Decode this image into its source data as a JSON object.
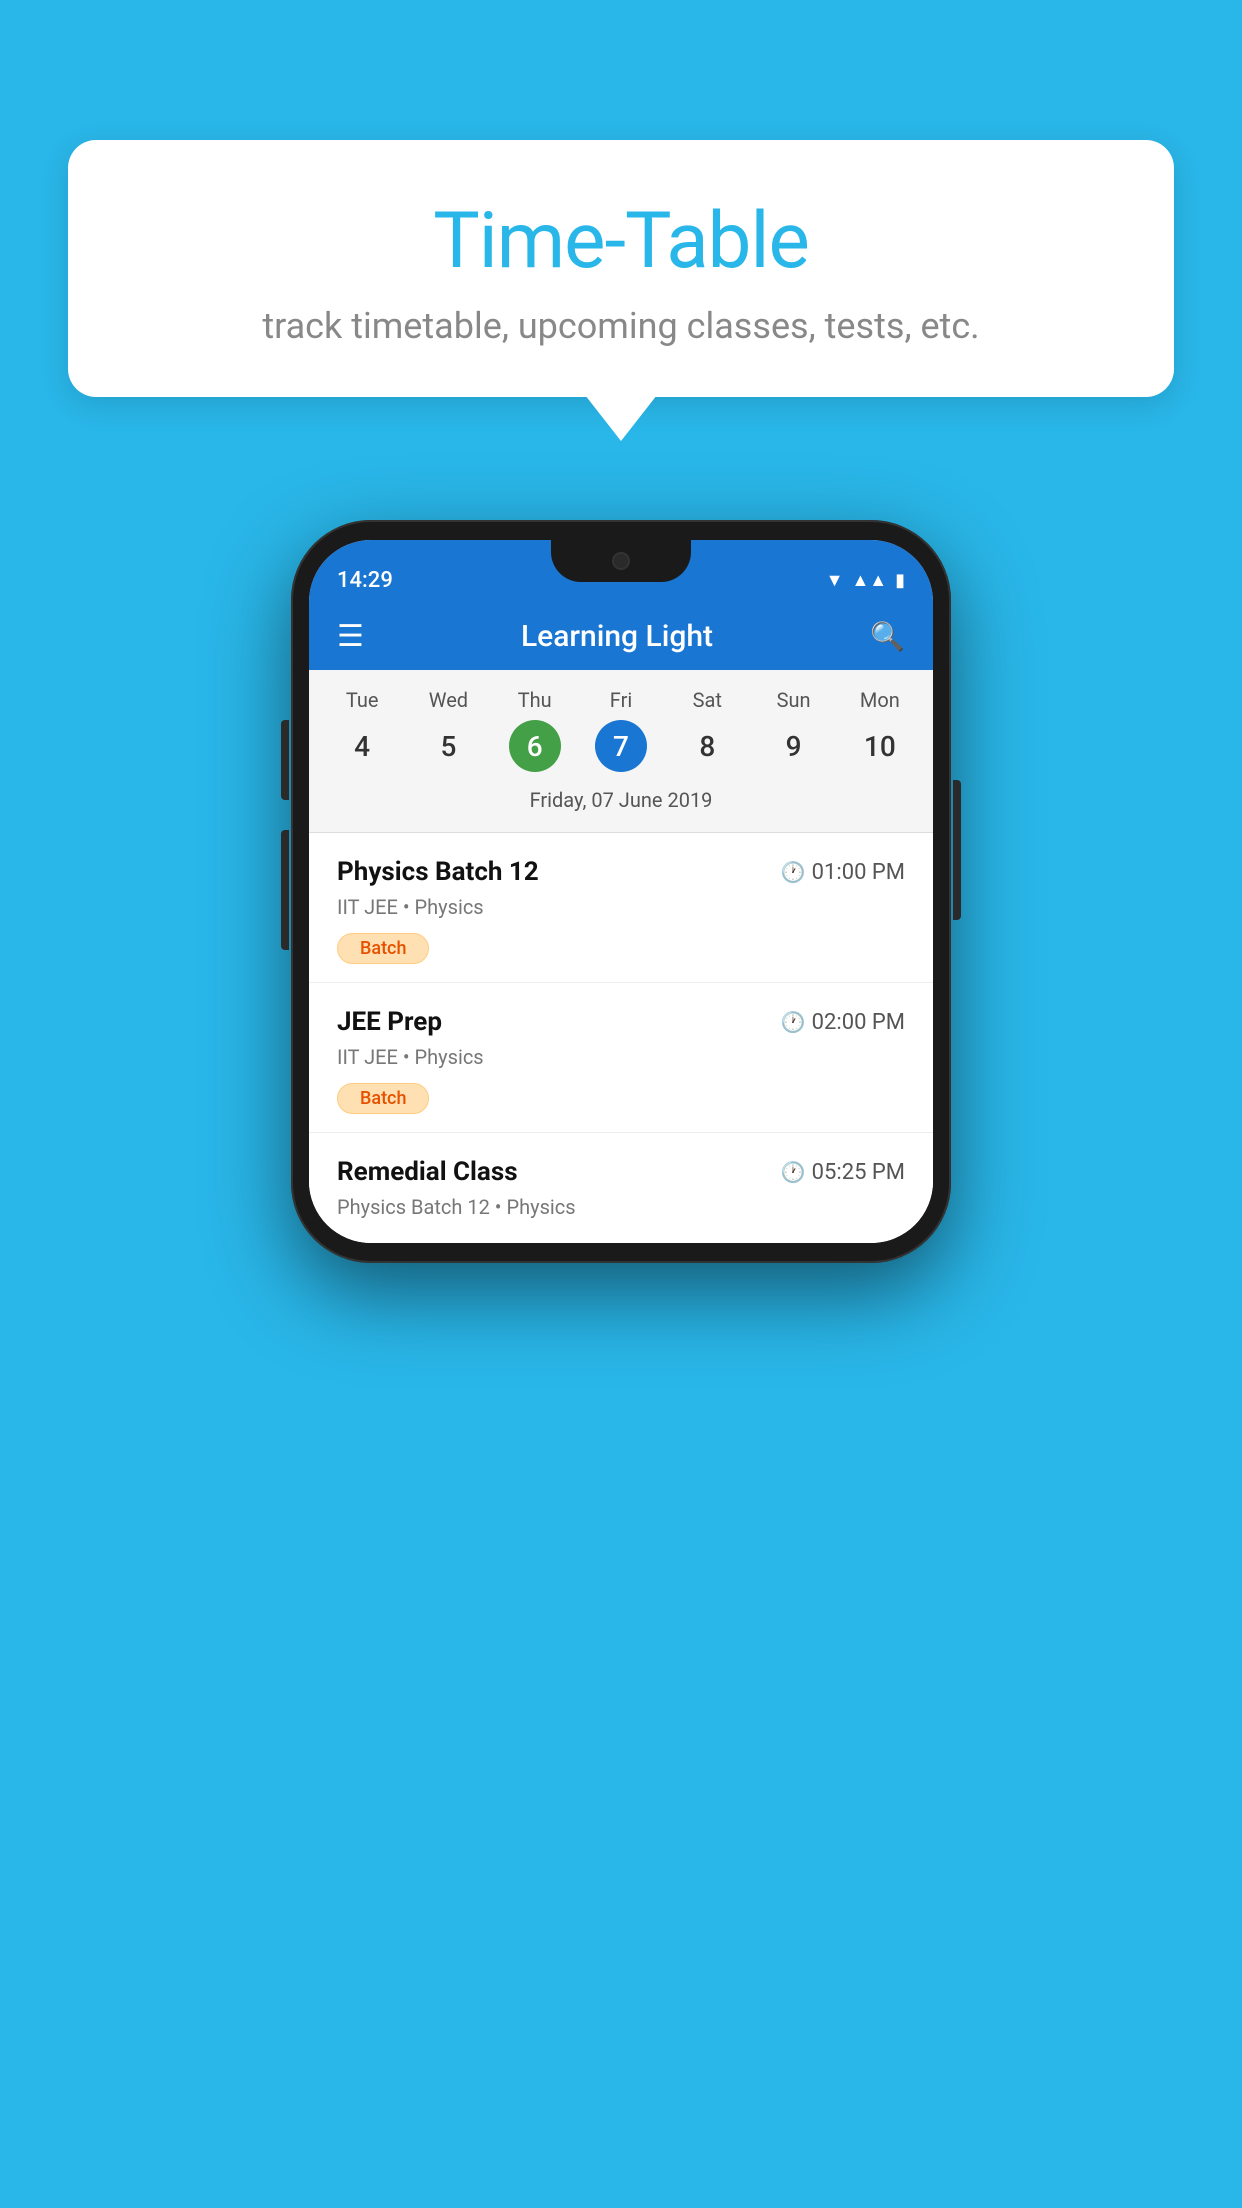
{
  "background_color": "#29b6e8",
  "tooltip": {
    "title": "Time-Table",
    "subtitle": "track timetable, upcoming classes, tests, etc."
  },
  "phone": {
    "status_bar": {
      "time": "14:29"
    },
    "app_bar": {
      "title": "Learning Light"
    },
    "calendar": {
      "days": [
        {
          "label": "Tue",
          "num": "4"
        },
        {
          "label": "Wed",
          "num": "5"
        },
        {
          "label": "Thu",
          "num": "6",
          "state": "today"
        },
        {
          "label": "Fri",
          "num": "7",
          "state": "selected"
        },
        {
          "label": "Sat",
          "num": "8"
        },
        {
          "label": "Sun",
          "num": "9"
        },
        {
          "label": "Mon",
          "num": "10"
        }
      ],
      "selected_date": "Friday, 07 June 2019"
    },
    "schedule": [
      {
        "title": "Physics Batch 12",
        "time": "01:00 PM",
        "subtitle": "IIT JEE • Physics",
        "badge": "Batch"
      },
      {
        "title": "JEE Prep",
        "time": "02:00 PM",
        "subtitle": "IIT JEE • Physics",
        "badge": "Batch"
      },
      {
        "title": "Remedial Class",
        "time": "05:25 PM",
        "subtitle": "Physics Batch 12 • Physics"
      }
    ]
  }
}
